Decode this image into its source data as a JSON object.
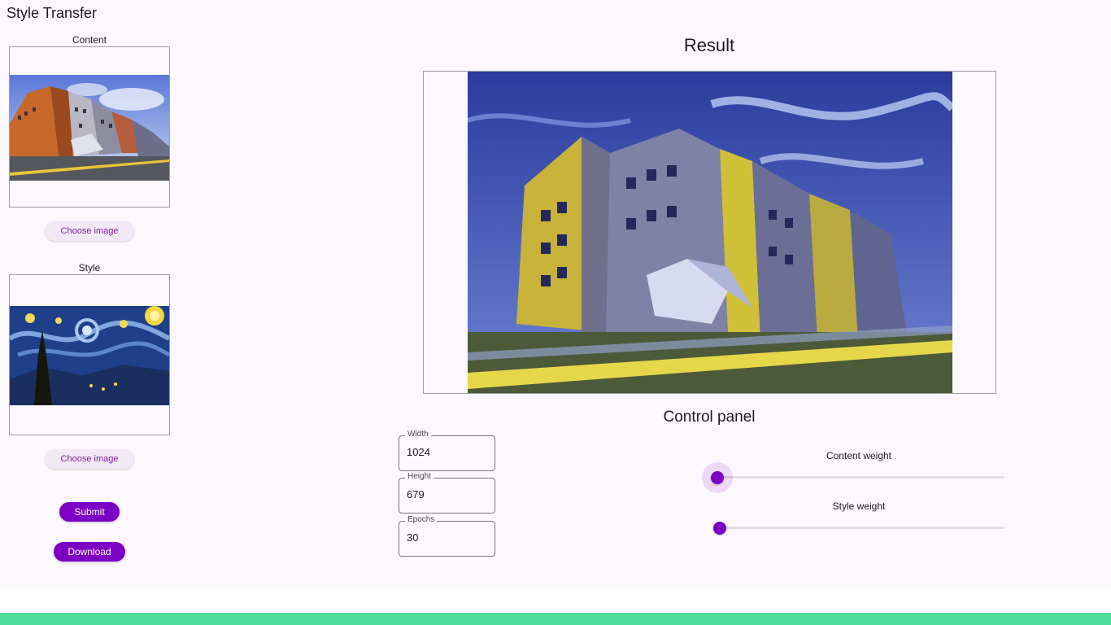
{
  "app": {
    "title": "Style Transfer"
  },
  "content": {
    "label": "Content",
    "choose_label": "Choose image"
  },
  "style": {
    "label": "Style",
    "choose_label": "Choose image"
  },
  "actions": {
    "submit_label": "Submit",
    "download_label": "Download"
  },
  "result": {
    "title": "Result"
  },
  "control_panel": {
    "title": "Control panel",
    "width": {
      "label": "Width",
      "value": "1024"
    },
    "height": {
      "label": "Height",
      "value": "679"
    },
    "epochs": {
      "label": "Epochs",
      "value": "30"
    },
    "content_weight": {
      "label": "Content weight",
      "value": 0.0
    },
    "style_weight": {
      "label": "Style weight",
      "value": 0.0
    }
  },
  "colors": {
    "accent": "#7b00c4",
    "background": "#fdf8fe",
    "bottom_bar": "#4ddd98"
  }
}
